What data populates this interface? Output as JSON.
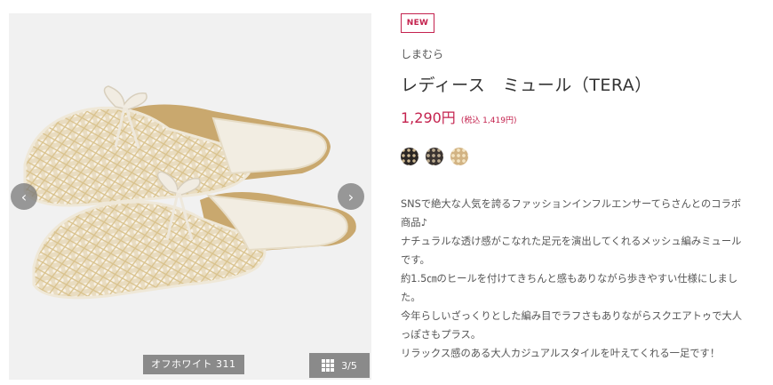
{
  "product": {
    "badge": "NEW",
    "brand": "しまむら",
    "title": "レディース　ミュール（TERA）",
    "price": "1,290円",
    "price_tax": "(税込 1,419円)",
    "color_caption": "オフホワイト 311",
    "image_counter": "3/5",
    "swatches": [
      "black-pattern",
      "dark-pattern",
      "beige-pattern"
    ],
    "description": [
      "SNSで絶大な人気を誇るファッションインフルエンサーてらさんとのコラボ",
      "商品♪",
      "ナチュラルな透け感がこなれた足元を演出してくれるメッシュ編みミュール",
      "です。",
      "約1.5㎝のヒールを付けてきちんと感もありながら歩きやすい仕様にしまし",
      "た。",
      "今年らしいざっくりとした編み目でラフさもありながらスクエアトゥで大人",
      "っぽさもプラス。",
      "リラックス感のある大人カジュアルスタイルを叶えてくれる一足です！"
    ]
  },
  "icons": {
    "prev": "‹",
    "next": "›"
  },
  "colors": {
    "accent": "#c4224e",
    "image_bg": "#f1f1f1",
    "overlay": "#787878"
  }
}
